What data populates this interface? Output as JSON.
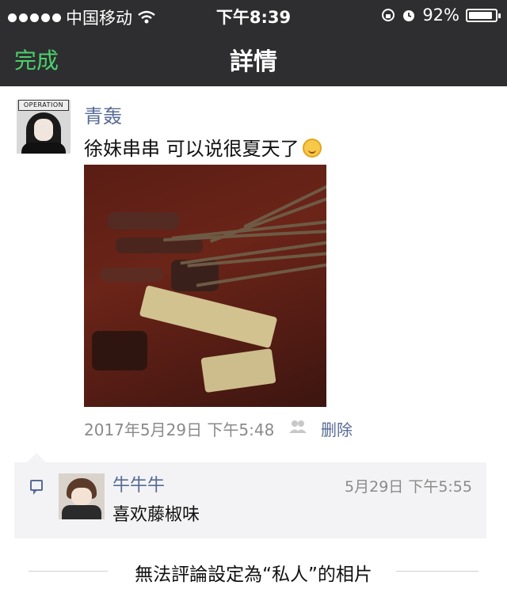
{
  "status_bar": {
    "carrier": "中国移动",
    "time": "下午8:39",
    "battery": "92%",
    "battery_level": 0.92,
    "icons": [
      "signal-dots-icon",
      "wifi-icon",
      "rotation-lock-icon",
      "alarm-icon",
      "battery-icon"
    ]
  },
  "nav": {
    "done": "完成",
    "title": "詳情"
  },
  "post": {
    "author": "青轰",
    "avatar_text": "OPERATION",
    "text": "徐妹串串 可以说很夏天了",
    "emoji": "smile-emoji-icon",
    "timestamp": "2017年5月29日 下午5:48",
    "delete_label": "删除"
  },
  "comment": {
    "author": "牛牛牛",
    "time": "5月29日 下午5:55",
    "text": "喜欢藤椒味"
  },
  "footer": {
    "notice": "無法評論設定為“私人”的相片"
  },
  "colors": {
    "accent_green": "#4cd06a",
    "link_blue": "#576b95",
    "bar_bg": "#2e2e31"
  }
}
